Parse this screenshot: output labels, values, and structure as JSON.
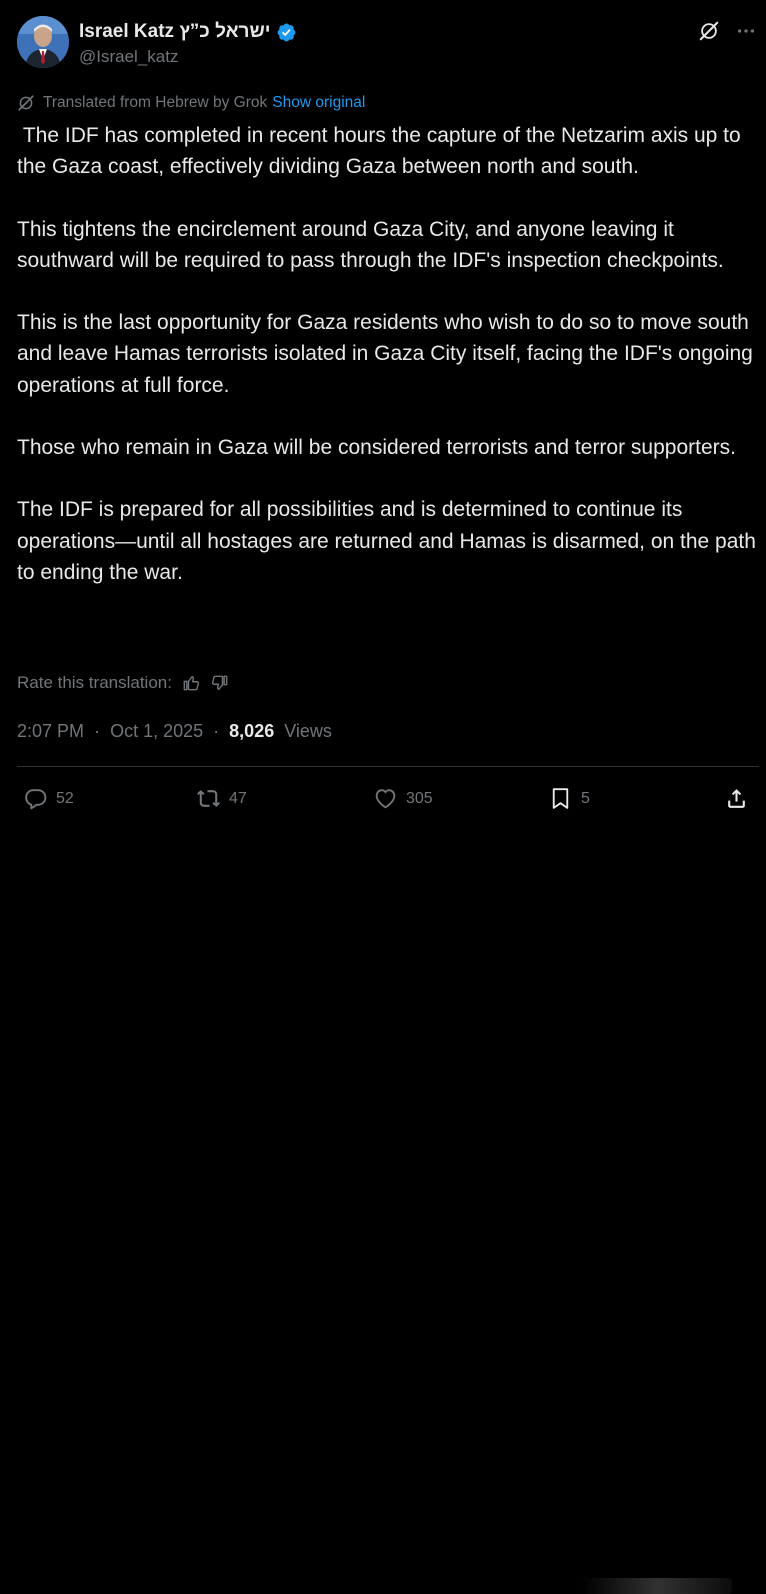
{
  "author": {
    "display_name": "ישראל כ”ץ Israel Katz",
    "handle": "@Israel_katz",
    "verified": true
  },
  "translation": {
    "notice": "Translated from Hebrew by Grok",
    "show_original_label": "Show original",
    "rate_label": "Rate this translation:"
  },
  "tweet": {
    "paragraphs": [
      " The IDF has completed in recent hours the capture of the Netzarim axis up to the Gaza coast, effectively dividing Gaza between north and south.",
      "This tightens the encirclement around Gaza City, and anyone leaving it southward will be required to pass through the IDF's inspection checkpoints.",
      "This is the last opportunity for Gaza residents who wish to do so to move south and leave Hamas terrorists isolated in Gaza City itself, facing the IDF's ongoing operations at full force.",
      "Those who remain in Gaza will be considered terrorists and terror supporters.",
      "The IDF is prepared for all possibilities and is determined to continue its operations—until all hostages are returned and Hamas is disarmed, on the path to ending the war."
    ],
    "time": "2:07 PM",
    "date": "Oct 1, 2025",
    "separator": "·",
    "views_count": "8,026",
    "views_label": "Views"
  },
  "actions": {
    "replies": "52",
    "reposts": "47",
    "likes": "305",
    "bookmarks": "5"
  },
  "colors": {
    "background": "#000000",
    "text": "#e7e9ea",
    "muted": "#71767b",
    "accent": "#1d9bf0",
    "divider": "#2f3336"
  },
  "icons": {
    "verified": "verified-badge-icon",
    "grok": "grok-icon",
    "more": "more-dots-icon",
    "translate": "grok-translate-icon",
    "thumb_up": "thumbs-up-icon",
    "thumb_down": "thumbs-down-icon",
    "reply": "reply-icon",
    "repost": "repost-icon",
    "like": "heart-icon",
    "bookmark": "bookmark-icon",
    "share": "share-icon"
  }
}
